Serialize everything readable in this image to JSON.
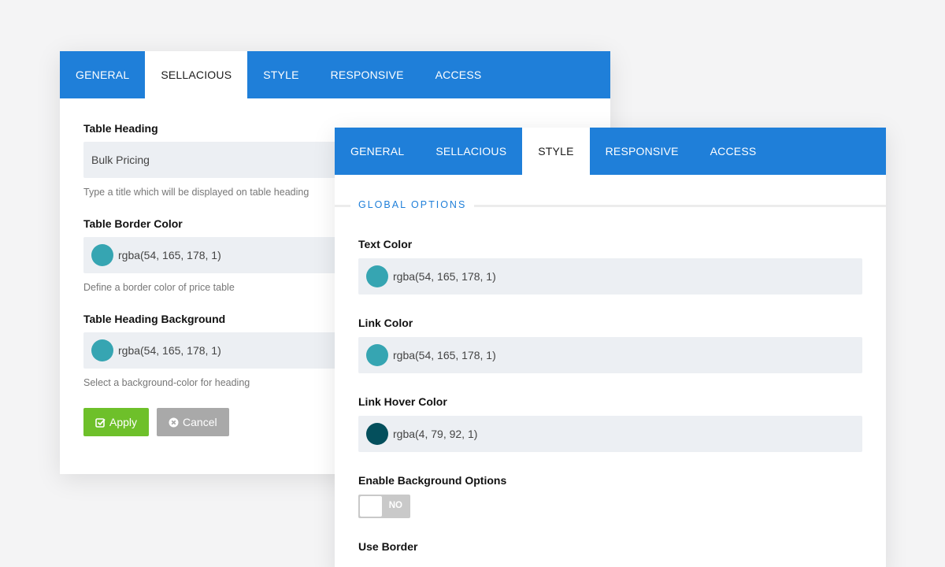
{
  "back_panel": {
    "tabs": [
      "GENERAL",
      "SELLACIOUS",
      "STYLE",
      "RESPONSIVE",
      "ACCESS"
    ],
    "active_tab": "SELLACIOUS",
    "fields": [
      {
        "label": "Table Heading",
        "value": "Bulk Pricing",
        "help": "Type a title which will be displayed on table heading"
      },
      {
        "label": "Table Border Color",
        "value": "rgba(54, 165, 178, 1)",
        "swatch": "#36a5b2",
        "help": "Define a border color of price table"
      },
      {
        "label": "Table Heading Background",
        "value": "rgba(54, 165, 178, 1)",
        "swatch": "#36a5b2",
        "help": "Select a background-color for heading"
      }
    ],
    "apply_label": "Apply",
    "cancel_label": "Cancel"
  },
  "front_panel": {
    "tabs": [
      "GENERAL",
      "SELLACIOUS",
      "STYLE",
      "RESPONSIVE",
      "ACCESS"
    ],
    "active_tab": "STYLE",
    "section_title": "GLOBAL OPTIONS",
    "fields": [
      {
        "label": "Text Color",
        "value": "rgba(54, 165, 178, 1)",
        "swatch": "#36a5b2"
      },
      {
        "label": "Link Color",
        "value": "rgba(54, 165, 178, 1)",
        "swatch": "#36a5b2"
      },
      {
        "label": "Link Hover Color",
        "value": "rgba(4, 79, 92, 1)",
        "swatch": "#044f5c"
      }
    ],
    "background_options": {
      "label": "Enable Background Options",
      "toggle": "NO"
    },
    "use_border_label": "Use Border"
  },
  "colors": {
    "tab_bar": "#1f7fd9",
    "apply": "#6ec02a",
    "cancel": "#a9a9a9",
    "accent": "#1f7fd9"
  }
}
